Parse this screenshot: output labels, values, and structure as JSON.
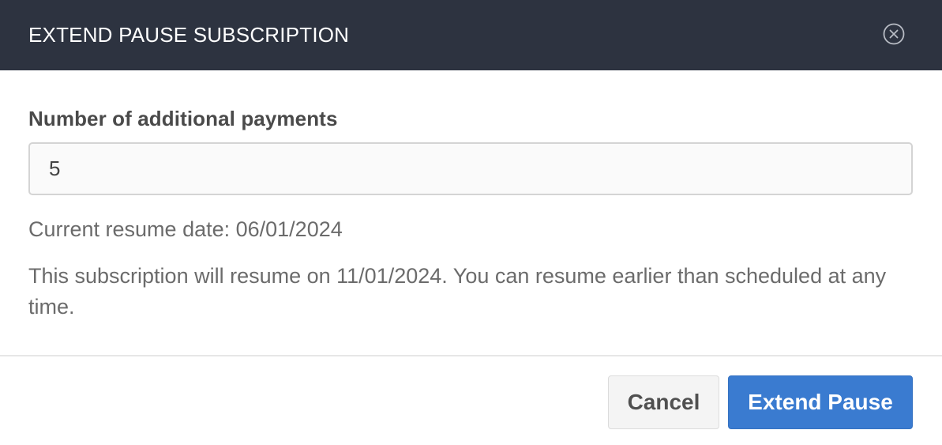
{
  "dialog": {
    "title": "EXTEND PAUSE SUBSCRIPTION",
    "close_icon": "close-circle-icon"
  },
  "form": {
    "label": "Number of additional payments",
    "value": "5"
  },
  "info": {
    "current_resume": "Current resume date: 06/01/2024",
    "resume_note": "This subscription will resume on 11/01/2024. You can resume earlier than scheduled at any time."
  },
  "footer": {
    "cancel_label": "Cancel",
    "confirm_label": "Extend Pause"
  },
  "colors": {
    "header_bg": "#2d3340",
    "primary": "#3a7bd0",
    "text_muted": "#6b6b6b"
  }
}
